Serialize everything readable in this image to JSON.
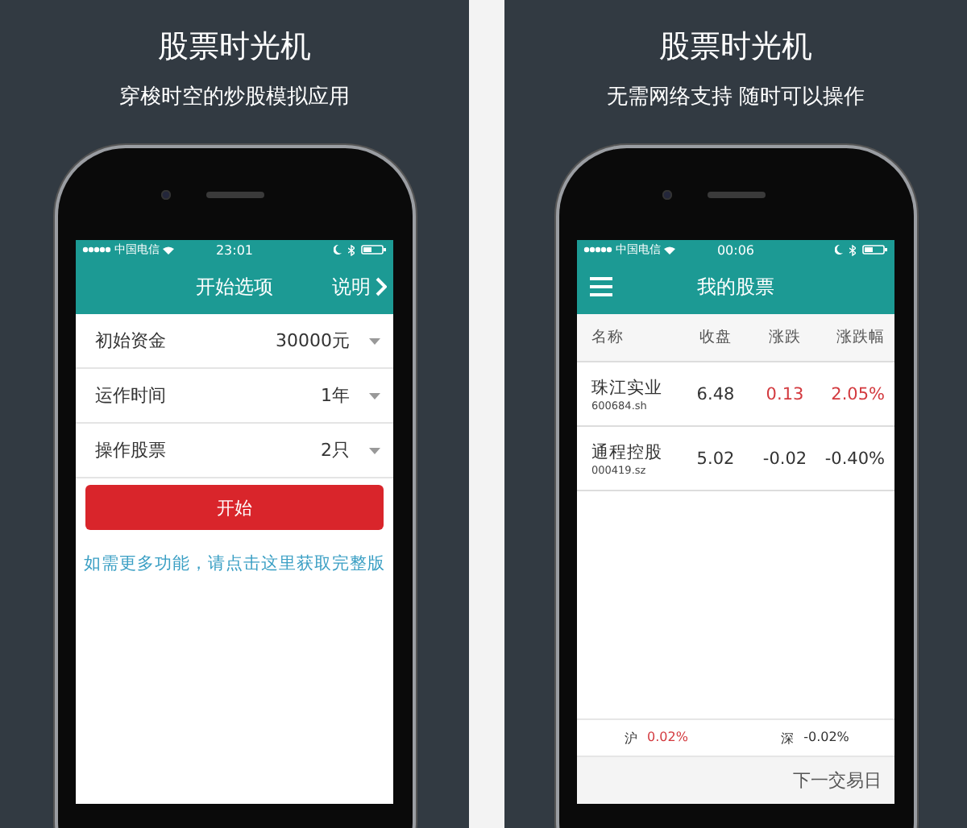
{
  "panels": [
    {
      "title": "股票时光机",
      "subtitle": "穿梭时空的炒股模拟应用",
      "phone": {
        "status_bar": {
          "carrier": "中国电信",
          "time": "23:01"
        },
        "screen": {
          "kind": "options",
          "header": {
            "title": "开始选项",
            "action": "说明"
          },
          "options": [
            {
              "label": "初始资金",
              "value": "30000元"
            },
            {
              "label": "运作时间",
              "value": "1年"
            },
            {
              "label": "操作股票",
              "value": "2只"
            }
          ],
          "start_button": "开始",
          "upgrade_link": "如需更多功能，请点击这里获取完整版"
        }
      }
    },
    {
      "title": "股票时光机",
      "subtitle": "无需网络支持  随时可以操作",
      "phone": {
        "status_bar": {
          "carrier": "中国电信",
          "time": "00:06"
        },
        "screen": {
          "kind": "portfolio",
          "header": {
            "title": "我的股票"
          },
          "columns": [
            "名称",
            "收盘",
            "涨跌",
            "涨跌幅"
          ],
          "rows": [
            {
              "name": "珠江实业",
              "code": "600684.sh",
              "close": "6.48",
              "change": "0.13",
              "change_pct": "2.05%",
              "color": "#d33a3f"
            },
            {
              "name": "通程控股",
              "code": "000419.sz",
              "close": "5.02",
              "change": "-0.02",
              "change_pct": "-0.40%",
              "color": "#333333"
            }
          ],
          "indices": [
            {
              "label": "沪",
              "value": "0.02%",
              "color": "#d33a3f"
            },
            {
              "label": "深",
              "value": "-0.02%",
              "color": "#333333"
            }
          ],
          "footer": "下一交易日"
        }
      }
    }
  ]
}
